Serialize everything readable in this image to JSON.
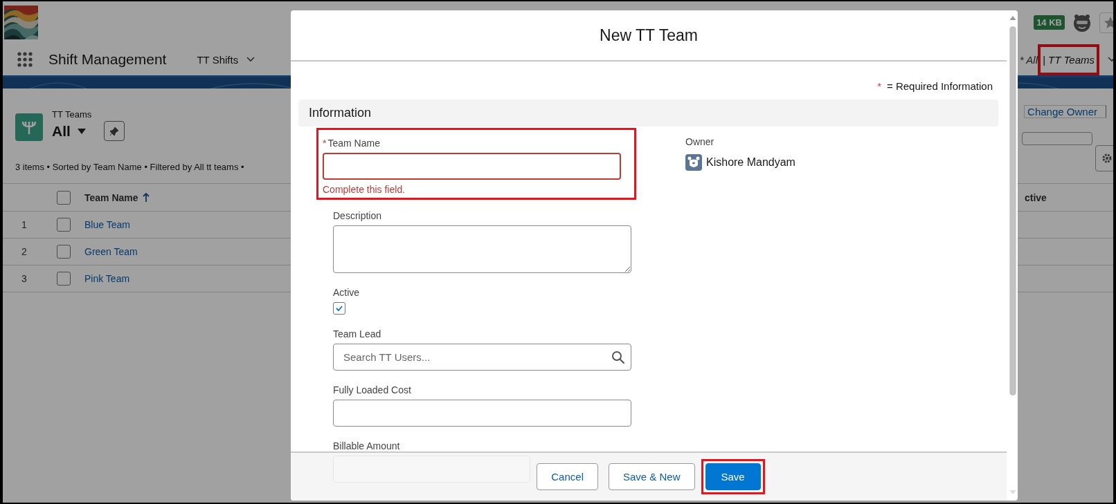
{
  "app": {
    "title": "Shift Management",
    "nav_items": [
      {
        "label": "TT Shifts"
      }
    ],
    "list_view_tab": {
      "prefix": "* All",
      "label": "| TT Teams",
      "highlighted": true
    },
    "storage_badge": "14 KB"
  },
  "list": {
    "object": "TT Teams",
    "view": "All",
    "buttons": [
      {
        "label": "Change Owner"
      }
    ],
    "summary": "3 items • Sorted by Team Name • Filtered by All tt teams •",
    "select_all_checked": false,
    "columns": [
      {
        "label": "Team Name",
        "sorted": true
      },
      {
        "label": "ctive"
      }
    ],
    "rows": [
      {
        "number": "1",
        "name": "Blue Team",
        "checked": false
      },
      {
        "number": "2",
        "name": "Green Team",
        "checked": false
      },
      {
        "number": "3",
        "name": "Pink Team",
        "checked": false
      }
    ]
  },
  "modal": {
    "title": "New TT Team",
    "required_note": {
      "mark": "*",
      "text": "= Required Information"
    },
    "section": "Information",
    "fields": [
      {
        "kind": "text",
        "label": "Team Name",
        "required_mark": "*",
        "error": "Complete this field.",
        "highlighted": true,
        "disabled": false
      },
      {
        "kind": "textarea",
        "label": "Description",
        "highlighted": false,
        "disabled": false
      },
      {
        "kind": "checkbox",
        "label": "Active",
        "checked": true,
        "highlighted": false,
        "disabled": false
      },
      {
        "kind": "lookup",
        "label": "Team Lead",
        "placeholder": "Search TT Users...",
        "highlighted": false,
        "disabled": false
      },
      {
        "kind": "text",
        "label": "Fully Loaded Cost",
        "highlighted": false,
        "disabled": false
      },
      {
        "kind": "text",
        "label": "Billable Amount",
        "highlighted": false,
        "disabled": true
      }
    ],
    "owner": {
      "label": "Owner",
      "name": "Kishore Mandyam"
    },
    "buttons": [
      {
        "label": "Cancel",
        "kind": "neutral",
        "highlighted": false
      },
      {
        "label": "Save & New",
        "kind": "neutral",
        "highlighted": false
      },
      {
        "label": "Save",
        "kind": "brand",
        "highlighted": true
      }
    ]
  }
}
